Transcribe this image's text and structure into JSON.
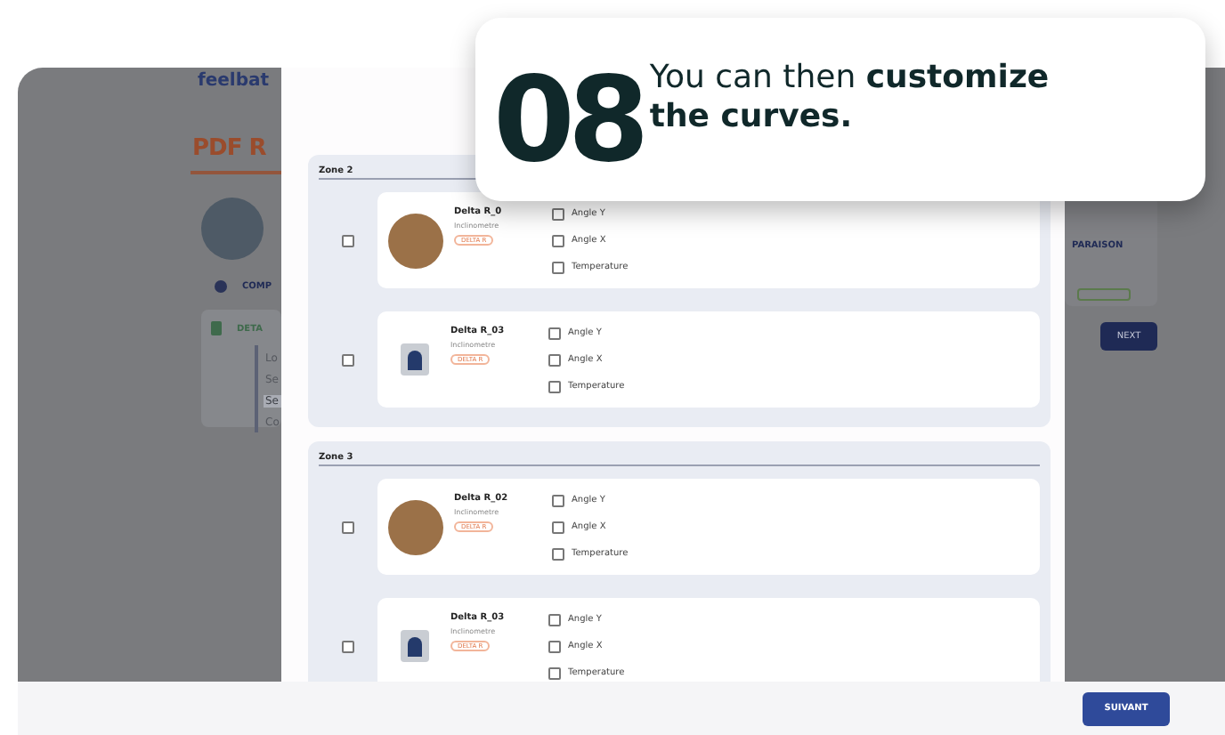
{
  "app": {
    "logo": "feelbat",
    "title": "PDF R",
    "menu": [
      {
        "label": "COMP",
        "kind": "link"
      },
      {
        "label": "DETA",
        "kind": "panel"
      }
    ],
    "sidebar": {
      "items": [
        {
          "label": "Lo",
          "selected": false
        },
        {
          "label": "Se",
          "selected": false
        },
        {
          "label": "Se",
          "selected": true
        },
        {
          "label": "Co",
          "selected": false
        }
      ]
    },
    "comparison_label": "PARAISON",
    "next_button": "NEXT"
  },
  "modal": {
    "zones": [
      {
        "title": "Zone 2",
        "sensors": [
          {
            "name": "Delta R_0",
            "type": "Inclinometre",
            "badge": "DELTA R",
            "kind": "round",
            "selected": false,
            "channels": [
              {
                "label": "Angle Y",
                "checked": false
              },
              {
                "label": "Angle X",
                "checked": false
              },
              {
                "label": "Temperature",
                "checked": false
              }
            ]
          },
          {
            "name": "Delta R_03",
            "type": "Inclinometre",
            "badge": "DELTA R",
            "kind": "device",
            "selected": false,
            "channels": [
              {
                "label": "Angle Y",
                "checked": false
              },
              {
                "label": "Angle X",
                "checked": false
              },
              {
                "label": "Temperature",
                "checked": false
              }
            ]
          }
        ]
      },
      {
        "title": "Zone 3",
        "sensors": [
          {
            "name": "Delta R_02",
            "type": "Inclinometre",
            "badge": "DELTA R",
            "kind": "round",
            "selected": false,
            "channels": [
              {
                "label": "Angle Y",
                "checked": false
              },
              {
                "label": "Angle X",
                "checked": false
              },
              {
                "label": "Temperature",
                "checked": false
              }
            ]
          },
          {
            "name": "Delta R_03",
            "type": "Inclinometre",
            "badge": "DELTA R",
            "kind": "device",
            "selected": false,
            "channels": [
              {
                "label": "Angle Y",
                "checked": false
              },
              {
                "label": "Angle X",
                "checked": false
              },
              {
                "label": "Temperature",
                "checked": false
              }
            ]
          }
        ]
      }
    ],
    "footer_button": "SUIVANT"
  },
  "callout": {
    "step": "08",
    "text": "You can then **customize the curves.**"
  }
}
